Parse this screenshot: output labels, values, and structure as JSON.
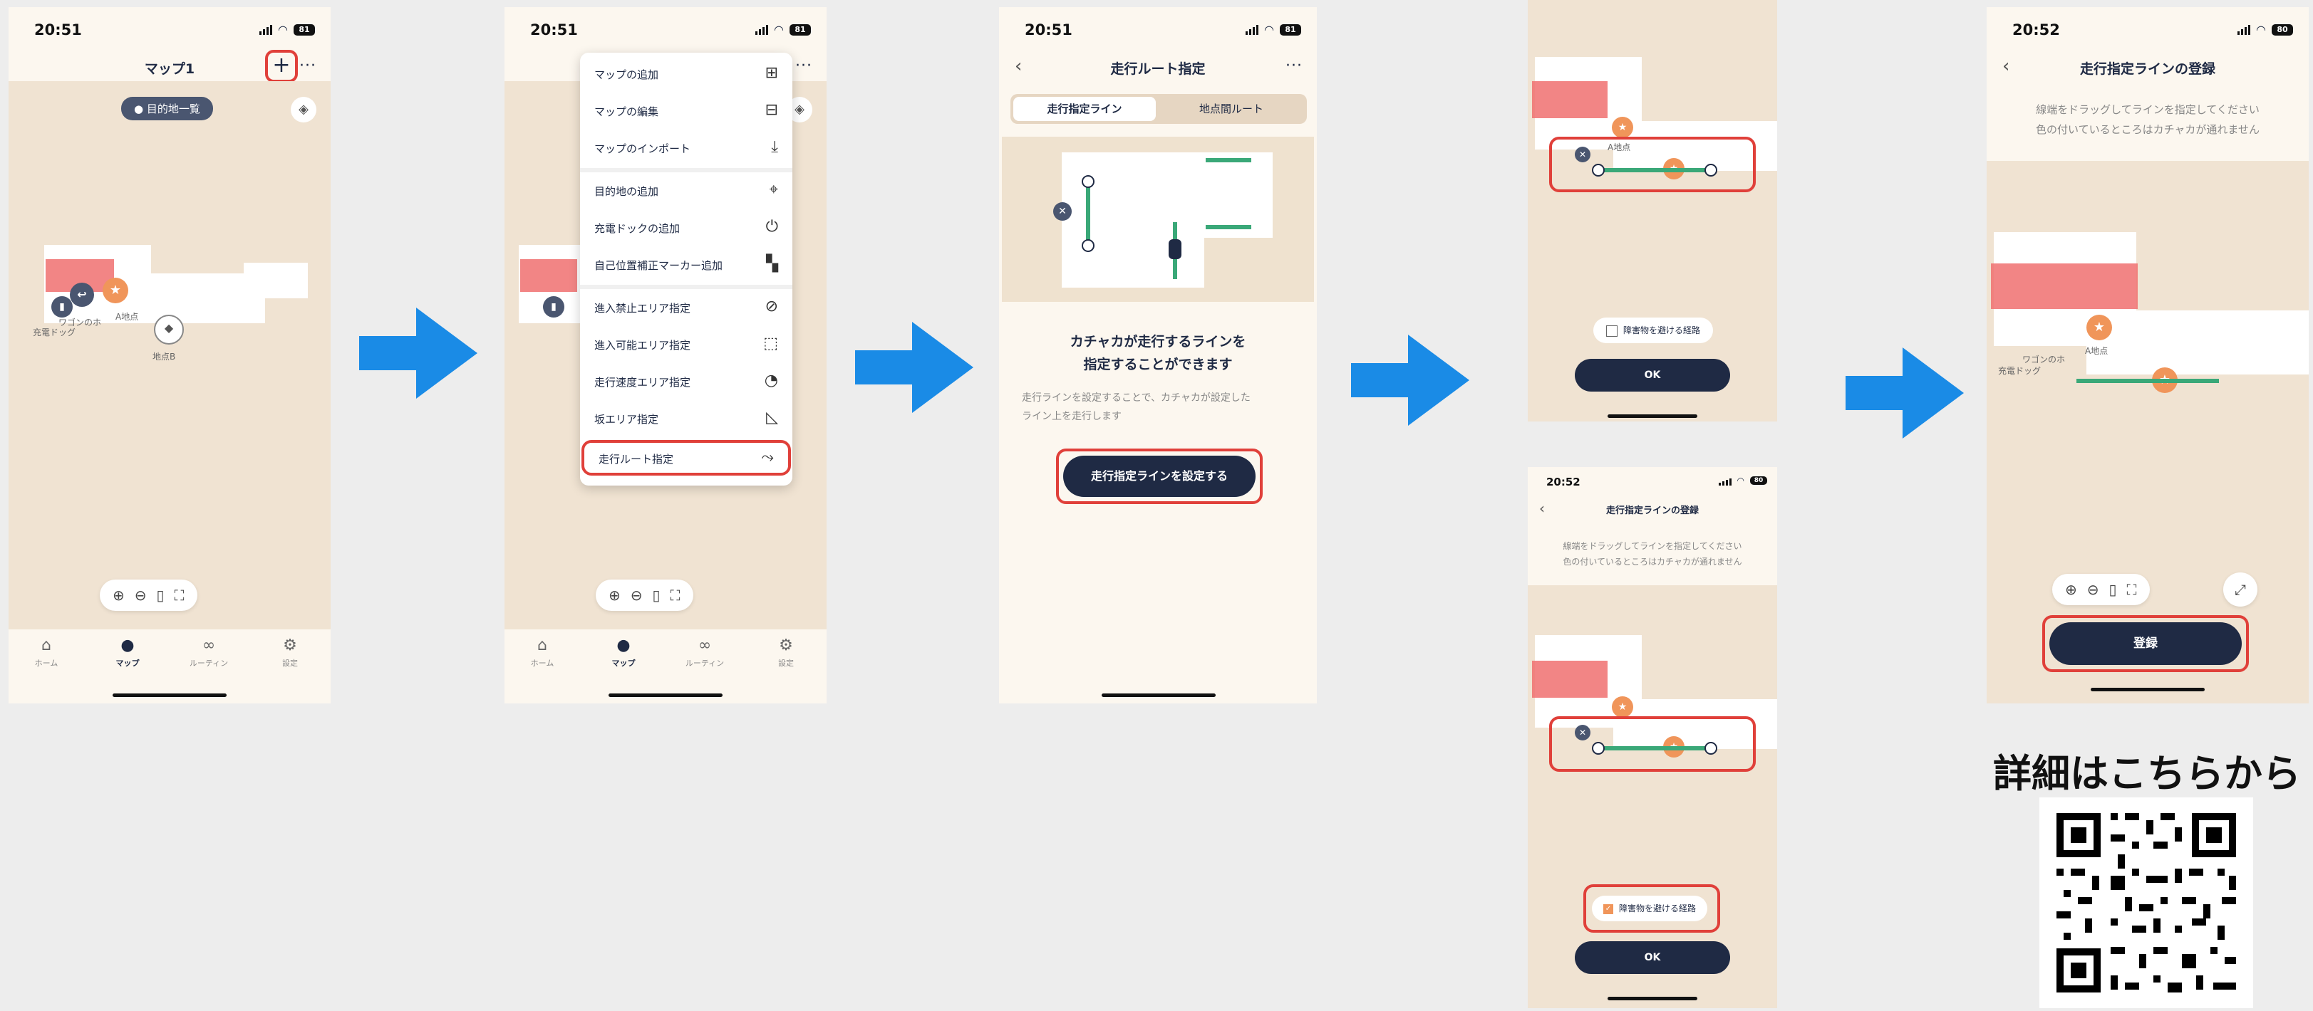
{
  "status": {
    "time1": "20:51",
    "time2": "20:51",
    "time3": "20:51",
    "time4": "20:52",
    "time5": "20:52",
    "battery1": "81",
    "battery2": "81",
    "battery3": "81",
    "battery4": "80",
    "battery5": "80"
  },
  "screen1": {
    "title": "マップ1",
    "add_icon": "+",
    "more_icon": "···",
    "destinations_pill": "目的地一覧",
    "label_wagon": "ワゴンのホ",
    "label_charge": "充電ドッグ",
    "label_a": "A地点",
    "label_b": "地点B"
  },
  "tabs": [
    "ホーム",
    "マップ",
    "ルーティン",
    "設定"
  ],
  "menu": {
    "items": [
      {
        "label": "マップの追加",
        "icon": "⊞"
      },
      {
        "label": "マップの編集",
        "icon": "⊟"
      },
      {
        "label": "マップのインポート",
        "icon": "⤓"
      },
      {
        "label": "目的地の追加",
        "icon": "⌖"
      },
      {
        "label": "充電ドックの追加",
        "icon": "⏻"
      },
      {
        "label": "自己位置補正マーカー追加",
        "icon": "▚"
      },
      {
        "label": "進入禁止エリア指定",
        "icon": "⊘"
      },
      {
        "label": "進入可能エリア指定",
        "icon": "⬚"
      },
      {
        "label": "走行速度エリア指定",
        "icon": "◔"
      },
      {
        "label": "坂エリア指定",
        "icon": "◺"
      },
      {
        "label": "走行ルート指定",
        "icon": "⤳"
      }
    ]
  },
  "screen3": {
    "title": "走行ルート指定",
    "seg_left": "走行指定ライン",
    "seg_right": "地点間ルート",
    "heading_line1": "カチャカが走行するラインを",
    "heading_line2": "指定することができます",
    "desc_line1": "走行ラインを設定することで、カチャカが設定した",
    "desc_line2": "ライン上を走行します",
    "button": "走行指定ラインを設定する"
  },
  "screen4": {
    "checkbox_label": "障害物を避ける経路",
    "ok": "OK",
    "title": "走行指定ラインの登録",
    "hint_line1": "線端をドラッグしてラインを指定してください",
    "hint_line2": "色の付いているところはカチャカが通れません",
    "label_a": "A地点"
  },
  "screen5": {
    "title": "走行指定ラインの登録",
    "hint_line1": "線端をドラッグしてラインを指定してください",
    "hint_line2": "色の付いているところはカチャカが通れません",
    "register": "登録",
    "label_a": "A地点",
    "label_wagon": "ワゴンのホ",
    "label_charge": "充電ドッグ"
  },
  "promo": {
    "text": "詳細はこちらから"
  },
  "colors": {
    "accent_red": "#e0403a",
    "arrow_blue": "#1a8be6",
    "navy": "#1f2a44",
    "route_green": "#3aa878",
    "map_bg": "#f0e3d2",
    "nogo_red": "#f07070",
    "pin_orange": "#f0955a"
  }
}
